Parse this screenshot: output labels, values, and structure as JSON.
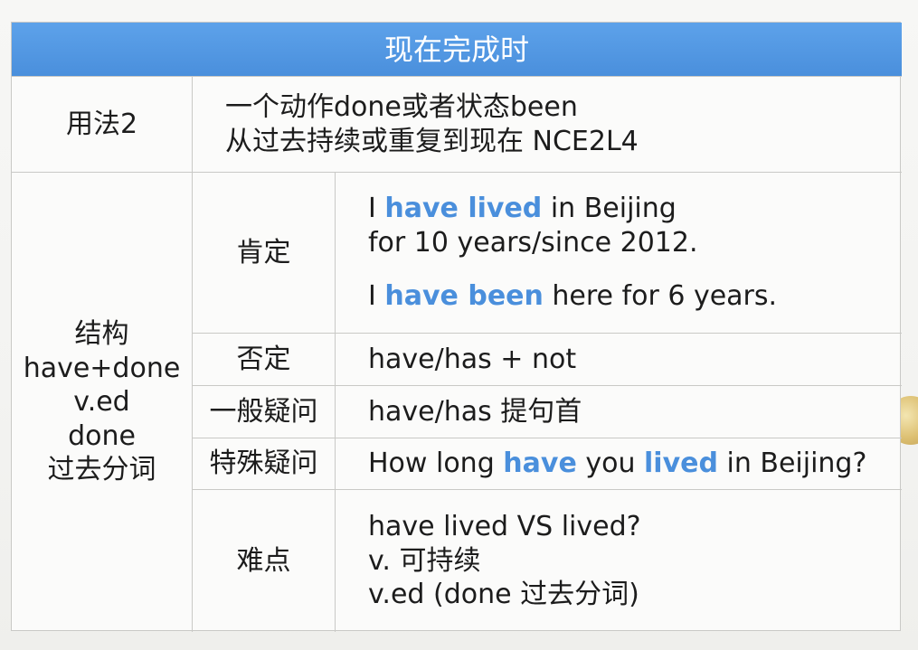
{
  "title": "现在完成时",
  "usage": {
    "label": "用法2",
    "line1": "一个动作done或者状态been",
    "line2": "从过去持续或重复到现在 NCE2L4"
  },
  "structure": {
    "lines": [
      "结构",
      "have+done",
      "v.ed",
      "done",
      "过去分词"
    ]
  },
  "rows": {
    "affirmative": {
      "label": "肯定",
      "ex1_a": "I ",
      "ex1_hl": "have lived",
      "ex1_b": " in Beijing",
      "ex1_line2": "for 10 years/since 2012.",
      "ex2_a": "I ",
      "ex2_hl": "have been",
      "ex2_b": " here for 6 years."
    },
    "negative": {
      "label": "否定",
      "text": "have/has + not"
    },
    "general_question": {
      "label": "一般疑问",
      "text": "have/has 提句首"
    },
    "special_question": {
      "label": "特殊疑问",
      "t1": "How long ",
      "hl1": "have",
      "t2": " you ",
      "hl2": "lived",
      "t3": " in Beijing?"
    },
    "difficulty": {
      "label": "难点",
      "line1": "have lived VS lived?",
      "line2": "v. 可持续",
      "line3": "v.ed (done 过去分词)"
    }
  },
  "colors": {
    "header_bg": "#4a8fdc",
    "highlight": "#4a8fdc"
  }
}
